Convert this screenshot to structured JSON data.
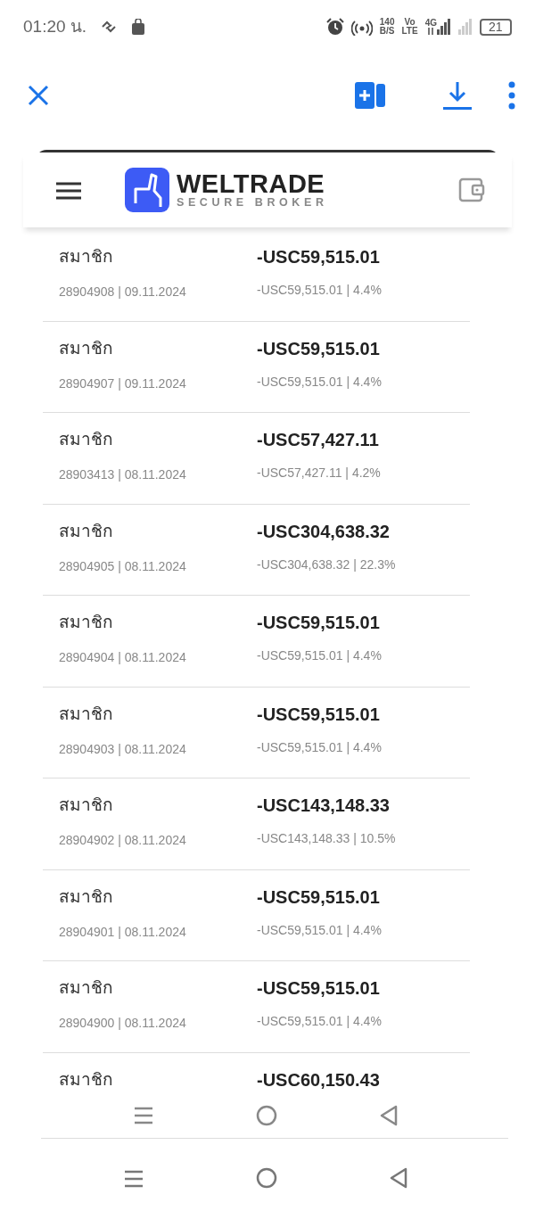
{
  "status_bar": {
    "time": "01:20 น.",
    "net_speed": "140",
    "net_unit": "B/S",
    "volte_top": "Vo",
    "volte_bottom": "LTE",
    "network": "4G",
    "battery": "21"
  },
  "brand": {
    "name": "WELTRADE",
    "tagline": "SECURE BROKER"
  },
  "rows": [
    {
      "name": "สมาชิก",
      "amount": "-USC59,515.01",
      "detail_id": "28904908 | 09.11.2024",
      "detail_amount": "-USC59,515.01 | 4.4%"
    },
    {
      "name": "สมาชิก",
      "amount": "-USC59,515.01",
      "detail_id": "28904907 | 09.11.2024",
      "detail_amount": "-USC59,515.01 | 4.4%"
    },
    {
      "name": "สมาชิก",
      "amount": "-USC57,427.11",
      "detail_id": "28903413 | 08.11.2024",
      "detail_amount": "-USC57,427.11 | 4.2%"
    },
    {
      "name": "สมาชิก",
      "amount": "-USC304,638.32",
      "detail_id": "28904905 | 08.11.2024",
      "detail_amount": "-USC304,638.32 | 22.3%"
    },
    {
      "name": "สมาชิก",
      "amount": "-USC59,515.01",
      "detail_id": "28904904 | 08.11.2024",
      "detail_amount": "-USC59,515.01 | 4.4%"
    },
    {
      "name": "สมาชิก",
      "amount": "-USC59,515.01",
      "detail_id": "28904903 | 08.11.2024",
      "detail_amount": "-USC59,515.01 | 4.4%"
    },
    {
      "name": "สมาชิก",
      "amount": "-USC143,148.33",
      "detail_id": "28904902 | 08.11.2024",
      "detail_amount": "-USC143,148.33 | 10.5%"
    },
    {
      "name": "สมาชิก",
      "amount": "-USC59,515.01",
      "detail_id": "28904901 | 08.11.2024",
      "detail_amount": "-USC59,515.01 | 4.4%"
    },
    {
      "name": "สมาชิก",
      "amount": "-USC59,515.01",
      "detail_id": "28904900 | 08.11.2024",
      "detail_amount": "-USC59,515.01 | 4.4%"
    },
    {
      "name": "สมาชิก",
      "amount": "-USC60,150.43"
    }
  ]
}
